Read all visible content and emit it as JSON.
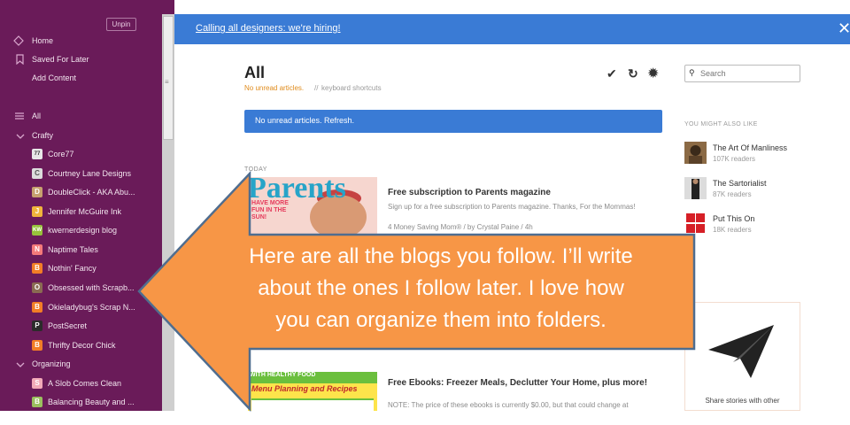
{
  "sidebar": {
    "unpin_label": "Unpin",
    "nav": [
      {
        "label": "Home",
        "icon": "home-icon"
      },
      {
        "label": "Saved For Later",
        "icon": "bookmark-icon"
      },
      {
        "label": "Add Content",
        "icon": ""
      }
    ],
    "all_label": "All",
    "folders": [
      {
        "label": "Crafty"
      },
      {
        "label": "Organizing"
      }
    ],
    "feeds": [
      {
        "label": "Core77",
        "color": "#e8e8e8",
        "glyph": "77"
      },
      {
        "label": "Courtney Lane Designs",
        "color": "#dcdcdc",
        "glyph": "C"
      },
      {
        "label": "DoubleClick - AKA Abu...",
        "color": "#c7a16f",
        "glyph": "D"
      },
      {
        "label": "Jennifer McGuire Ink",
        "color": "#f0b43c",
        "glyph": "J"
      },
      {
        "label": "kwernerdesign blog",
        "color": "#97c23b",
        "glyph": "KW"
      },
      {
        "label": "Naptime Tales",
        "color": "#f47a7a",
        "glyph": "N"
      },
      {
        "label": "Nothin' Fancy",
        "color": "#f27d26",
        "glyph": "B"
      },
      {
        "label": "Obsessed with Scrapb...",
        "color": "#8a6b52",
        "glyph": "O"
      },
      {
        "label": "Okieladybug's Scrap N...",
        "color": "#f27d26",
        "glyph": "B"
      },
      {
        "label": "PostSecret",
        "color": "#2b2b2b",
        "glyph": "P"
      },
      {
        "label": "Thrifty Decor Chick",
        "color": "#f27d26",
        "glyph": "B"
      },
      {
        "label": "A Slob Comes Clean",
        "color": "#f2a9b8",
        "glyph": "S"
      },
      {
        "label": "Balancing Beauty and ...",
        "color": "#9bbf5f",
        "glyph": "B"
      }
    ]
  },
  "banner": {
    "link": "Calling all designers: we're hiring!",
    "close": "✕"
  },
  "header": {
    "title": "All",
    "unread": "No unread articles.",
    "separator": "//",
    "shortcuts": "keyboard shortcuts"
  },
  "toolbar": {
    "check_icon": "✔",
    "refresh_icon": "↻",
    "gear_icon": "✹"
  },
  "search": {
    "placeholder": "Search",
    "icon": "⚲"
  },
  "alert": {
    "text": "No unread articles. Refresh."
  },
  "section": {
    "today": "TODAY"
  },
  "articles": [
    {
      "title": "Free subscription to Parents magazine",
      "desc": "Sign up for a free subscription to Parents magazine. Thanks, For the Mommas!",
      "meta": "4  Money Saving Mom® / by Crystal Paine / 4h",
      "thumb_masthead": "Parents",
      "thumb_cover": "HAVE MORE FUN IN THE SUN!"
    },
    {
      "title": "Free Ebooks: Freezer Meals, Declutter Your Home, plus more!",
      "desc": "NOTE: The price of these ebooks is currently $0.00, but that could change at",
      "thumb_header": "WITH HEALTHY FOOD",
      "thumb_cover": "Menu Planning and Recipes"
    }
  ],
  "right": {
    "heading": "YOU MIGHT ALSO LIKE",
    "suggestions": [
      {
        "name": "The Art Of Manliness",
        "count": "107K readers"
      },
      {
        "name": "The Sartorialist",
        "count": "87K readers"
      },
      {
        "name": "Put This On",
        "count": "18K readers"
      }
    ],
    "share_text": "Share stories with other"
  },
  "callout": {
    "lines": [
      "Here are all the blogs you follow.  I’ll write",
      "about the ones I follow later. I love how",
      "you can organize them into folders."
    ],
    "fill": "#f79646",
    "stroke": "#4f6d8f"
  }
}
